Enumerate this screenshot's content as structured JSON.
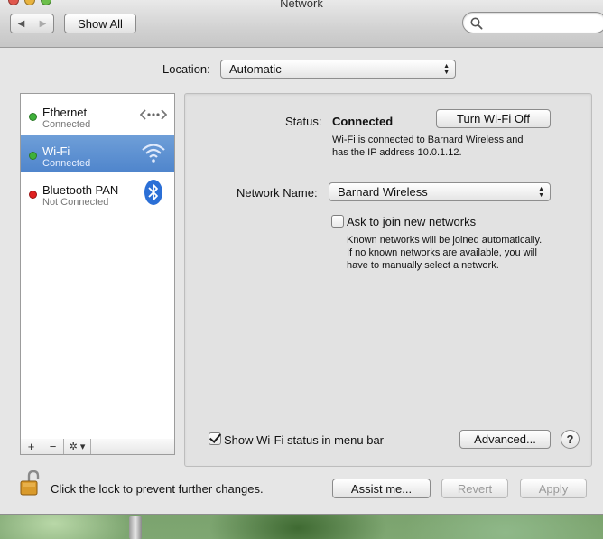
{
  "window": {
    "title": "Network",
    "nav_back": "◀",
    "nav_forward": "▶",
    "show_all": "Show All",
    "search_placeholder": ""
  },
  "location": {
    "label": "Location:",
    "value": "Automatic"
  },
  "services": [
    {
      "name": "Ethernet",
      "status": "Connected",
      "status_color": "#3fb13a",
      "icon": "ethernet-icon"
    },
    {
      "name": "Wi-Fi",
      "status": "Connected",
      "status_color": "#3fb13a",
      "icon": "wifi-icon",
      "selected": true
    },
    {
      "name": "Bluetooth PAN",
      "status": "Not Connected",
      "status_color": "#e02020",
      "icon": "bluetooth-icon"
    }
  ],
  "sidebar_tools": {
    "add": "+",
    "remove": "−",
    "gear": "✲ ▾"
  },
  "detail": {
    "status_label": "Status:",
    "status_value": "Connected",
    "turn_off_button": "Turn Wi-Fi Off",
    "status_description_line1": "Wi-Fi is connected to Barnard Wireless and",
    "status_description_line2": "has the IP address 10.0.1.12.",
    "network_name_label": "Network Name:",
    "network_name_value": "Barnard Wireless",
    "ask_join_label": "Ask to join new networks",
    "ask_join_checked": false,
    "ask_join_desc_line1": "Known networks will be joined automatically.",
    "ask_join_desc_line2": "If no known networks are available, you will",
    "ask_join_desc_line3": "have to manually select a network.",
    "show_status_label": "Show Wi-Fi status in menu bar",
    "show_status_checked": true,
    "advanced_button": "Advanced...",
    "help_button": "?"
  },
  "footer": {
    "lock_text": "Click the lock to prevent further changes.",
    "assist_button": "Assist me...",
    "revert_button": "Revert",
    "apply_button": "Apply"
  },
  "colors": {
    "selection": "#5289cf",
    "connected": "#3fb13a",
    "not_connected": "#e02020"
  }
}
